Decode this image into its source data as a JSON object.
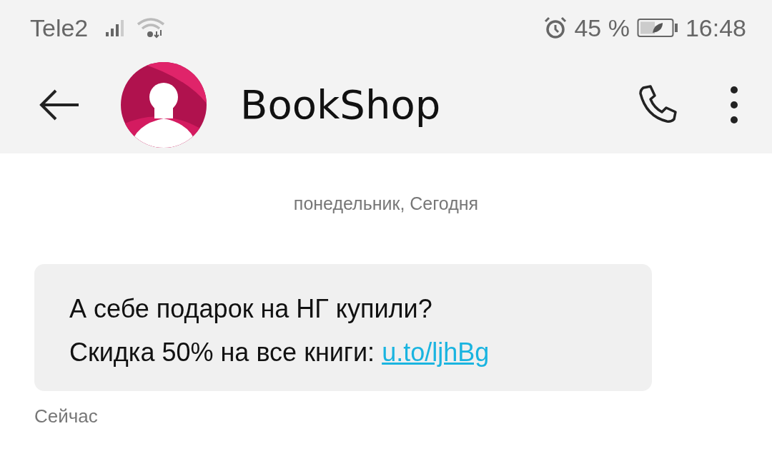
{
  "status_bar": {
    "carrier": "Tele2",
    "battery_percent": "45 %",
    "time": "16:48"
  },
  "header": {
    "contact_name": "BookShop"
  },
  "thread": {
    "date_divider": "понедельник, Сегодня",
    "messages": [
      {
        "text": "А себе подарок на НГ купили?\nСкидка 50% на все книги: ",
        "link": "u.to/ljhBg",
        "time": "Сейчас"
      }
    ]
  }
}
